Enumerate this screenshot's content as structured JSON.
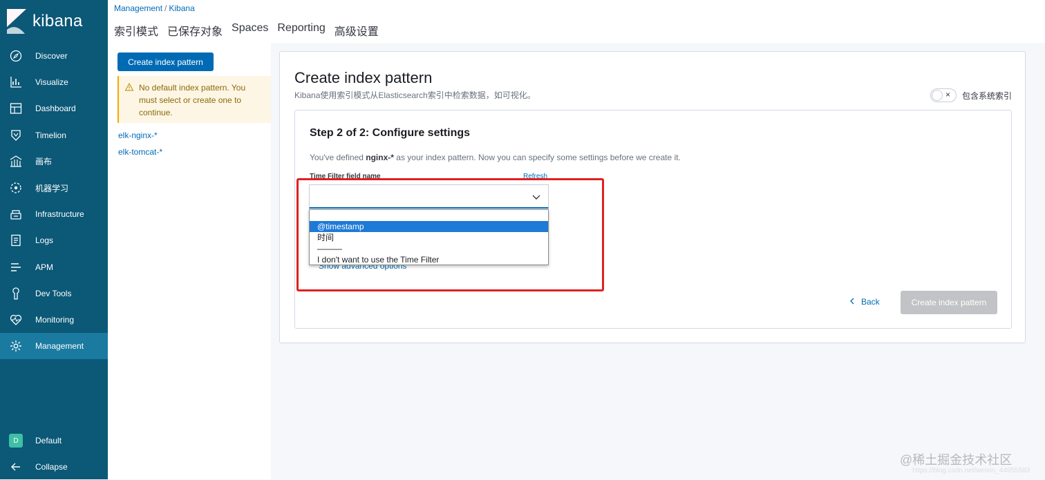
{
  "app": {
    "name": "kibana"
  },
  "sidebar": {
    "items": [
      {
        "label": "Discover",
        "icon": "compass-icon"
      },
      {
        "label": "Visualize",
        "icon": "chart-icon"
      },
      {
        "label": "Dashboard",
        "icon": "dashboard-icon"
      },
      {
        "label": "Timelion",
        "icon": "shield-icon"
      },
      {
        "label": "画布",
        "icon": "canvas-icon"
      },
      {
        "label": "机器学习",
        "icon": "ml-icon"
      },
      {
        "label": "Infrastructure",
        "icon": "infra-icon"
      },
      {
        "label": "Logs",
        "icon": "logs-icon"
      },
      {
        "label": "APM",
        "icon": "apm-icon"
      },
      {
        "label": "Dev Tools",
        "icon": "wrench-icon"
      },
      {
        "label": "Monitoring",
        "icon": "heartbeat-icon"
      },
      {
        "label": "Management",
        "icon": "gear-icon",
        "active": true
      }
    ],
    "space": {
      "badge": "D",
      "label": "Default"
    },
    "collapse_label": "Collapse"
  },
  "breadcrumb": {
    "first": "Management",
    "separator": "/",
    "second": "Kibana"
  },
  "tabs": [
    "索引模式",
    "已保存对象",
    "Spaces",
    "Reporting",
    "高级设置"
  ],
  "left_panel": {
    "create_button": "Create index pattern",
    "warning": "No default index pattern. You must select or create one to continue.",
    "patterns": [
      "elk-nginx-*",
      "elk-tomcat-*"
    ]
  },
  "main": {
    "title": "Create index pattern",
    "subtitle": "Kibana使用索引模式从Elasticsearch索引中检索数据，如可视化。",
    "toggle_label": "包含系统索引",
    "toggle_mark": "×",
    "step": {
      "title": "Step 2 of 2: Configure settings",
      "desc_prefix": "You've defined ",
      "desc_pattern": "nginx-*",
      "desc_suffix": " as your index pattern. Now you can specify some settings before we create it.",
      "field_label": "Time Filter field name",
      "refresh": "Refresh",
      "select_value": "",
      "options": [
        "@timestamp",
        "时间",
        "———",
        "I don't want to use the Time Filter"
      ],
      "selected_option": "@timestamp",
      "advanced": "Show advanced options",
      "back": "Back",
      "create_button": "Create index pattern"
    }
  },
  "watermark": {
    "main": "@稀土掘金技术社区",
    "faint": "https://blog.csdn.net/weixin_44955583"
  },
  "colors": {
    "sidebar": "#0b5877",
    "accent": "#006bb4",
    "annotation": "#e0201f",
    "selected_option": "#1e7ad7"
  }
}
